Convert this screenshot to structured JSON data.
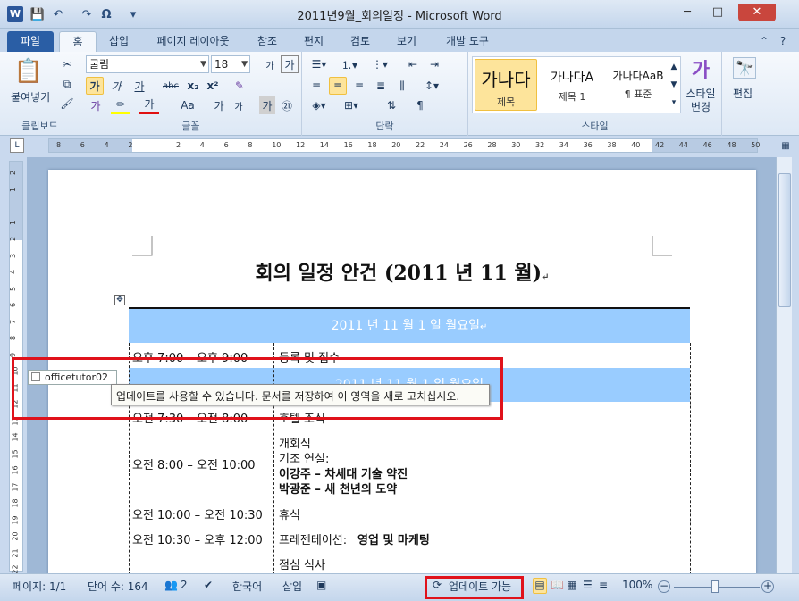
{
  "window": {
    "title": "2011년9월_회의일정 - Microsoft Word",
    "app_logo": "W",
    "controls": {
      "minimize": "─",
      "maximize": "□",
      "close": "✕"
    }
  },
  "qat": {
    "save_icon": "💾",
    "undo": "↶",
    "redo": "↷",
    "symbol": "Ω",
    "custom": "▾"
  },
  "tabs": [
    "파일",
    "홈",
    "삽입",
    "페이지 레이아웃",
    "참조",
    "편지",
    "검토",
    "보기",
    "개발 도구"
  ],
  "ribbon": {
    "clipboard": {
      "paste_label": "붙여넣기",
      "group_label": "클립보드"
    },
    "font": {
      "font_name": "굴림",
      "font_size": "18",
      "group_label": "글꼴",
      "bold": "가",
      "italic": "가",
      "underline": "가",
      "strike": "abc",
      "sub": "x₂",
      "sup": "x²",
      "case": "Aa",
      "grow": "가",
      "shrink": "가"
    },
    "paragraph": {
      "group_label": "단락"
    },
    "styles": {
      "group_label": "스타일",
      "items": [
        {
          "sample": "가나다",
          "name": "제목"
        },
        {
          "sample": "가나다A",
          "name": "제목 1"
        },
        {
          "sample": "가나다AaB",
          "name": "¶ 표준"
        }
      ],
      "change_label": "스타일\n변경"
    },
    "editing": {
      "label": "편집"
    }
  },
  "ruler_ticks": [
    "8",
    "6",
    "4",
    "2",
    "",
    "2",
    "4",
    "6",
    "8",
    "10",
    "12",
    "14",
    "16",
    "18",
    "20",
    "22",
    "24",
    "26",
    "28",
    "30",
    "32",
    "34",
    "36",
    "38",
    "40",
    "42",
    "44",
    "46",
    "48",
    "50"
  ],
  "document": {
    "title": "회의 일정 안건 (2011 년 11 월)",
    "band1": "2011 년 11 월 1 일 월요일",
    "band2": "2011 년 11 월 1 일 월요일",
    "rows": [
      {
        "time": "오후 7:00 – 오후 9:00",
        "desc": "등록 및 접수"
      },
      {
        "time": "오전 7:30 – 오전 8:00",
        "desc": "호텔 조식"
      },
      {
        "time": "오전 8:00 – 오전 10:00",
        "desc": "개회식"
      },
      {
        "time": "오전 10:00 – 오전 10:30",
        "desc": "휴식"
      },
      {
        "time": "오전 10:30 – 오후 12:00",
        "desc": "프레젠테이션:"
      },
      {
        "time": "",
        "desc": "점심 식사"
      }
    ],
    "keynote": "기조 연설:",
    "speaker1": "이강주 – 차세대 기술 약진",
    "speaker2": "박광준 – 새 천년의 도약",
    "presentation_topic": "영업 및 마케팅",
    "para_mark": "↵"
  },
  "coauthor": {
    "user": "officetutor02",
    "tooltip": "업데이트를 사용할 수 있습니다. 문서를 저장하여 이 영역을 새로 고치십시오."
  },
  "status": {
    "page": "페이지: 1/1",
    "words": "단어 수: 164",
    "authors": "2",
    "language": "한국어",
    "mode": "삽입",
    "update": "업데이트 가능",
    "zoom": "100%"
  },
  "colors": {
    "band": "#99ccff",
    "highlight": "#e0121b",
    "file_tab": "#2a5ea5"
  }
}
